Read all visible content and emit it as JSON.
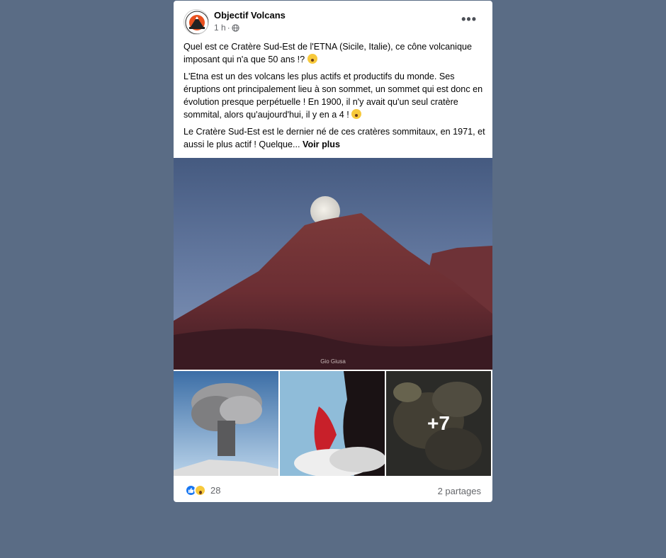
{
  "post": {
    "page_name": "Objectif Volcans",
    "time": "1 h",
    "separator": "·",
    "privacy_icon": "globe-icon",
    "more_icon": "more-options-icon",
    "more_label": "•••",
    "paragraphs": [
      "Quel est ce Cratère Sud-Est de l'ETNA (Sicile, Italie), ce cône volcanique imposant qui n'a que 50 ans !?",
      "L'Etna est un des volcans les plus actifs et productifs du monde. Ses éruptions ont principalement lieu à son sommet, un sommet qui est donc en évolution presque perpétuelle ! En 1900, il n'y avait qu'un seul cratère sommital, alors qu'aujourd'hui, il y en a 4 !",
      "Le Cratère Sud-Est est le dernier né de ces cratères sommitaux, en 1971, et aussi le plus actif ! Quelque..."
    ],
    "see_more": "Voir plus",
    "photo_credit": "Gio Giusa",
    "more_photos": "+7"
  },
  "footer": {
    "reaction_icons": [
      "like-icon",
      "wow-icon"
    ],
    "reaction_count": "28",
    "shares": "2 partages"
  },
  "colors": {
    "background": "#5a6c85",
    "card": "#ffffff",
    "secondary_text": "#65676b",
    "like_blue": "#1877f2"
  }
}
